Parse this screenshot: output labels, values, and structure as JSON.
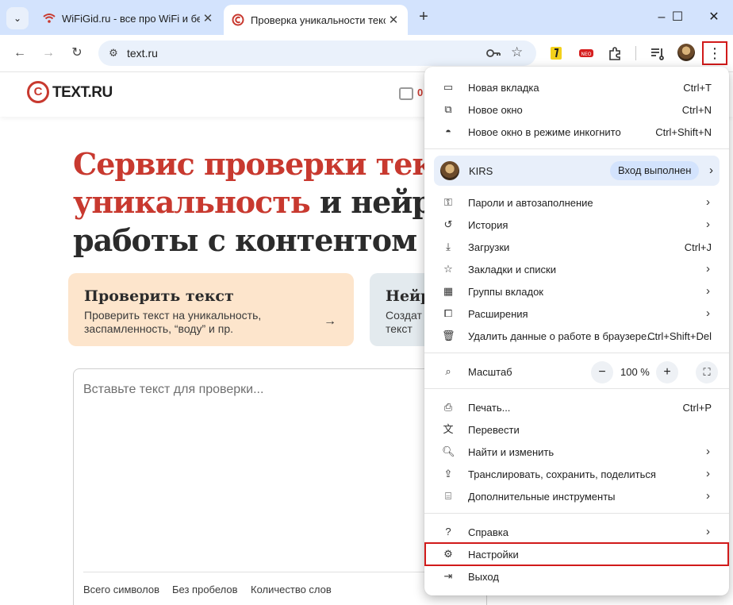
{
  "window_controls": {
    "minimize": "–",
    "maximize": "☐",
    "close": "✕"
  },
  "tabs": [
    {
      "title": "WiFiGid.ru - все про WiFi и бес",
      "close": "✕"
    },
    {
      "title": "Проверка уникальности текст",
      "close": "✕"
    }
  ],
  "new_tab": "+",
  "toolbar": {
    "url": "text.ru",
    "menu_glyph": "⋮"
  },
  "page": {
    "logo_mark": "C",
    "logo_text": "TEXT.RU",
    "header_counter": "0",
    "hero": {
      "line1": "Сервис проверки текс",
      "line2_red": "уникальность",
      "line2_dark": " и нейро",
      "line3": "работы с контентом"
    },
    "card_check": {
      "title": "Проверить текст",
      "subtitle": "Проверить текст на уникальность, заспамленность, “воду” и пр.",
      "arrow": "→"
    },
    "card_neuro": {
      "title": "Нейр",
      "subtitle": "Создат текст"
    },
    "textarea_placeholder": "Вставьте текст для проверки...",
    "stats": [
      "Всего символов",
      "Без пробелов",
      "Количество слов"
    ]
  },
  "menu": {
    "group1": [
      {
        "label": "Новая вкладка",
        "shortcut": "Ctrl+T",
        "icon": "new-tab-icon"
      },
      {
        "label": "Новое окно",
        "shortcut": "Ctrl+N",
        "icon": "new-window-icon"
      },
      {
        "label": "Новое окно в режиме инкогнито",
        "shortcut": "Ctrl+Shift+N",
        "icon": "incognito-icon"
      }
    ],
    "profile": {
      "name": "KIRS",
      "status": "Вход выполнен"
    },
    "group2": [
      {
        "label": "Пароли и автозаполнение",
        "icon": "key-icon",
        "submenu": true
      },
      {
        "label": "История",
        "icon": "history-icon",
        "submenu": true
      },
      {
        "label": "Загрузки",
        "shortcut": "Ctrl+J",
        "icon": "download-icon"
      },
      {
        "label": "Закладки и списки",
        "icon": "star-icon",
        "submenu": true
      },
      {
        "label": "Группы вкладок",
        "icon": "tab-groups-icon",
        "submenu": true
      },
      {
        "label": "Расширения",
        "icon": "puzzle-icon",
        "submenu": true
      },
      {
        "label": "Удалить данные о работе в браузере...",
        "shortcut": "Ctrl+Shift+Del",
        "icon": "trash-icon"
      }
    ],
    "zoom": {
      "label": "Масштаб",
      "minus": "−",
      "value": "100 %",
      "plus": "+"
    },
    "group3": [
      {
        "label": "Печать...",
        "shortcut": "Ctrl+P",
        "icon": "print-icon"
      },
      {
        "label": "Перевести",
        "icon": "translate-icon"
      },
      {
        "label": "Найти и изменить",
        "icon": "find-icon",
        "submenu": true
      },
      {
        "label": "Транслировать, сохранить, поделиться",
        "icon": "cast-icon",
        "submenu": true
      },
      {
        "label": "Дополнительные инструменты",
        "icon": "toolbox-icon",
        "submenu": true
      }
    ],
    "group4": [
      {
        "label": "Справка",
        "icon": "help-icon",
        "submenu": true
      },
      {
        "label": "Настройки",
        "icon": "gear-icon"
      },
      {
        "label": "Выход",
        "icon": "exit-icon"
      }
    ],
    "chevron": "›"
  },
  "colors": {
    "accent_red": "#c8392f",
    "highlight": "#d11a1a",
    "tabstrip": "#d3e3fd"
  }
}
